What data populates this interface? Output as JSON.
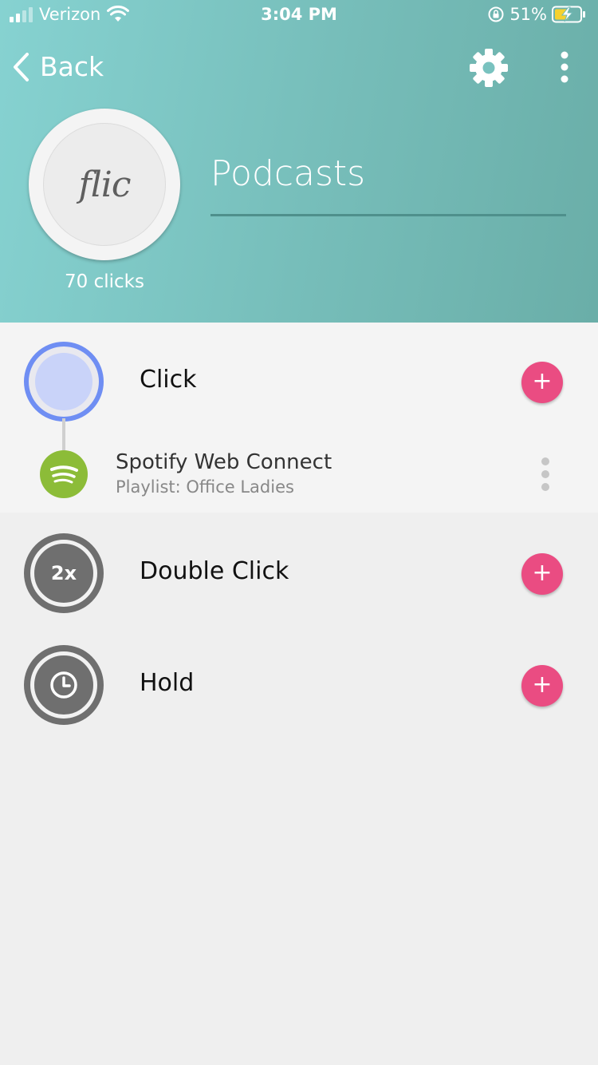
{
  "status_bar": {
    "carrier": "Verizon",
    "time": "3:04 PM",
    "battery_percent": "51%"
  },
  "nav": {
    "back_label": "Back",
    "settings_icon": "gear-icon",
    "more_icon": "more-vertical-icon"
  },
  "button": {
    "logo_text": "flic",
    "clicks": "70 clicks",
    "name": "Podcasts"
  },
  "events": [
    {
      "label": "Click",
      "icon": "click-icon",
      "icon_text": ""
    },
    {
      "label": "Double Click",
      "icon": "double-click-icon",
      "icon_text": "2x"
    },
    {
      "label": "Hold",
      "icon": "hold-clock-icon",
      "icon_text": ""
    }
  ],
  "click_action": {
    "title": "Spotify Web Connect",
    "subtitle": "Playlist: Office Ladies",
    "icon": "spotify-icon"
  },
  "add_label": "+",
  "colors": {
    "header_start": "#86d2d1",
    "header_end": "#6aaea8",
    "add_button": "#ea4c82",
    "click_ring": "#6f8ef3",
    "spotify": "#8cbc38"
  }
}
